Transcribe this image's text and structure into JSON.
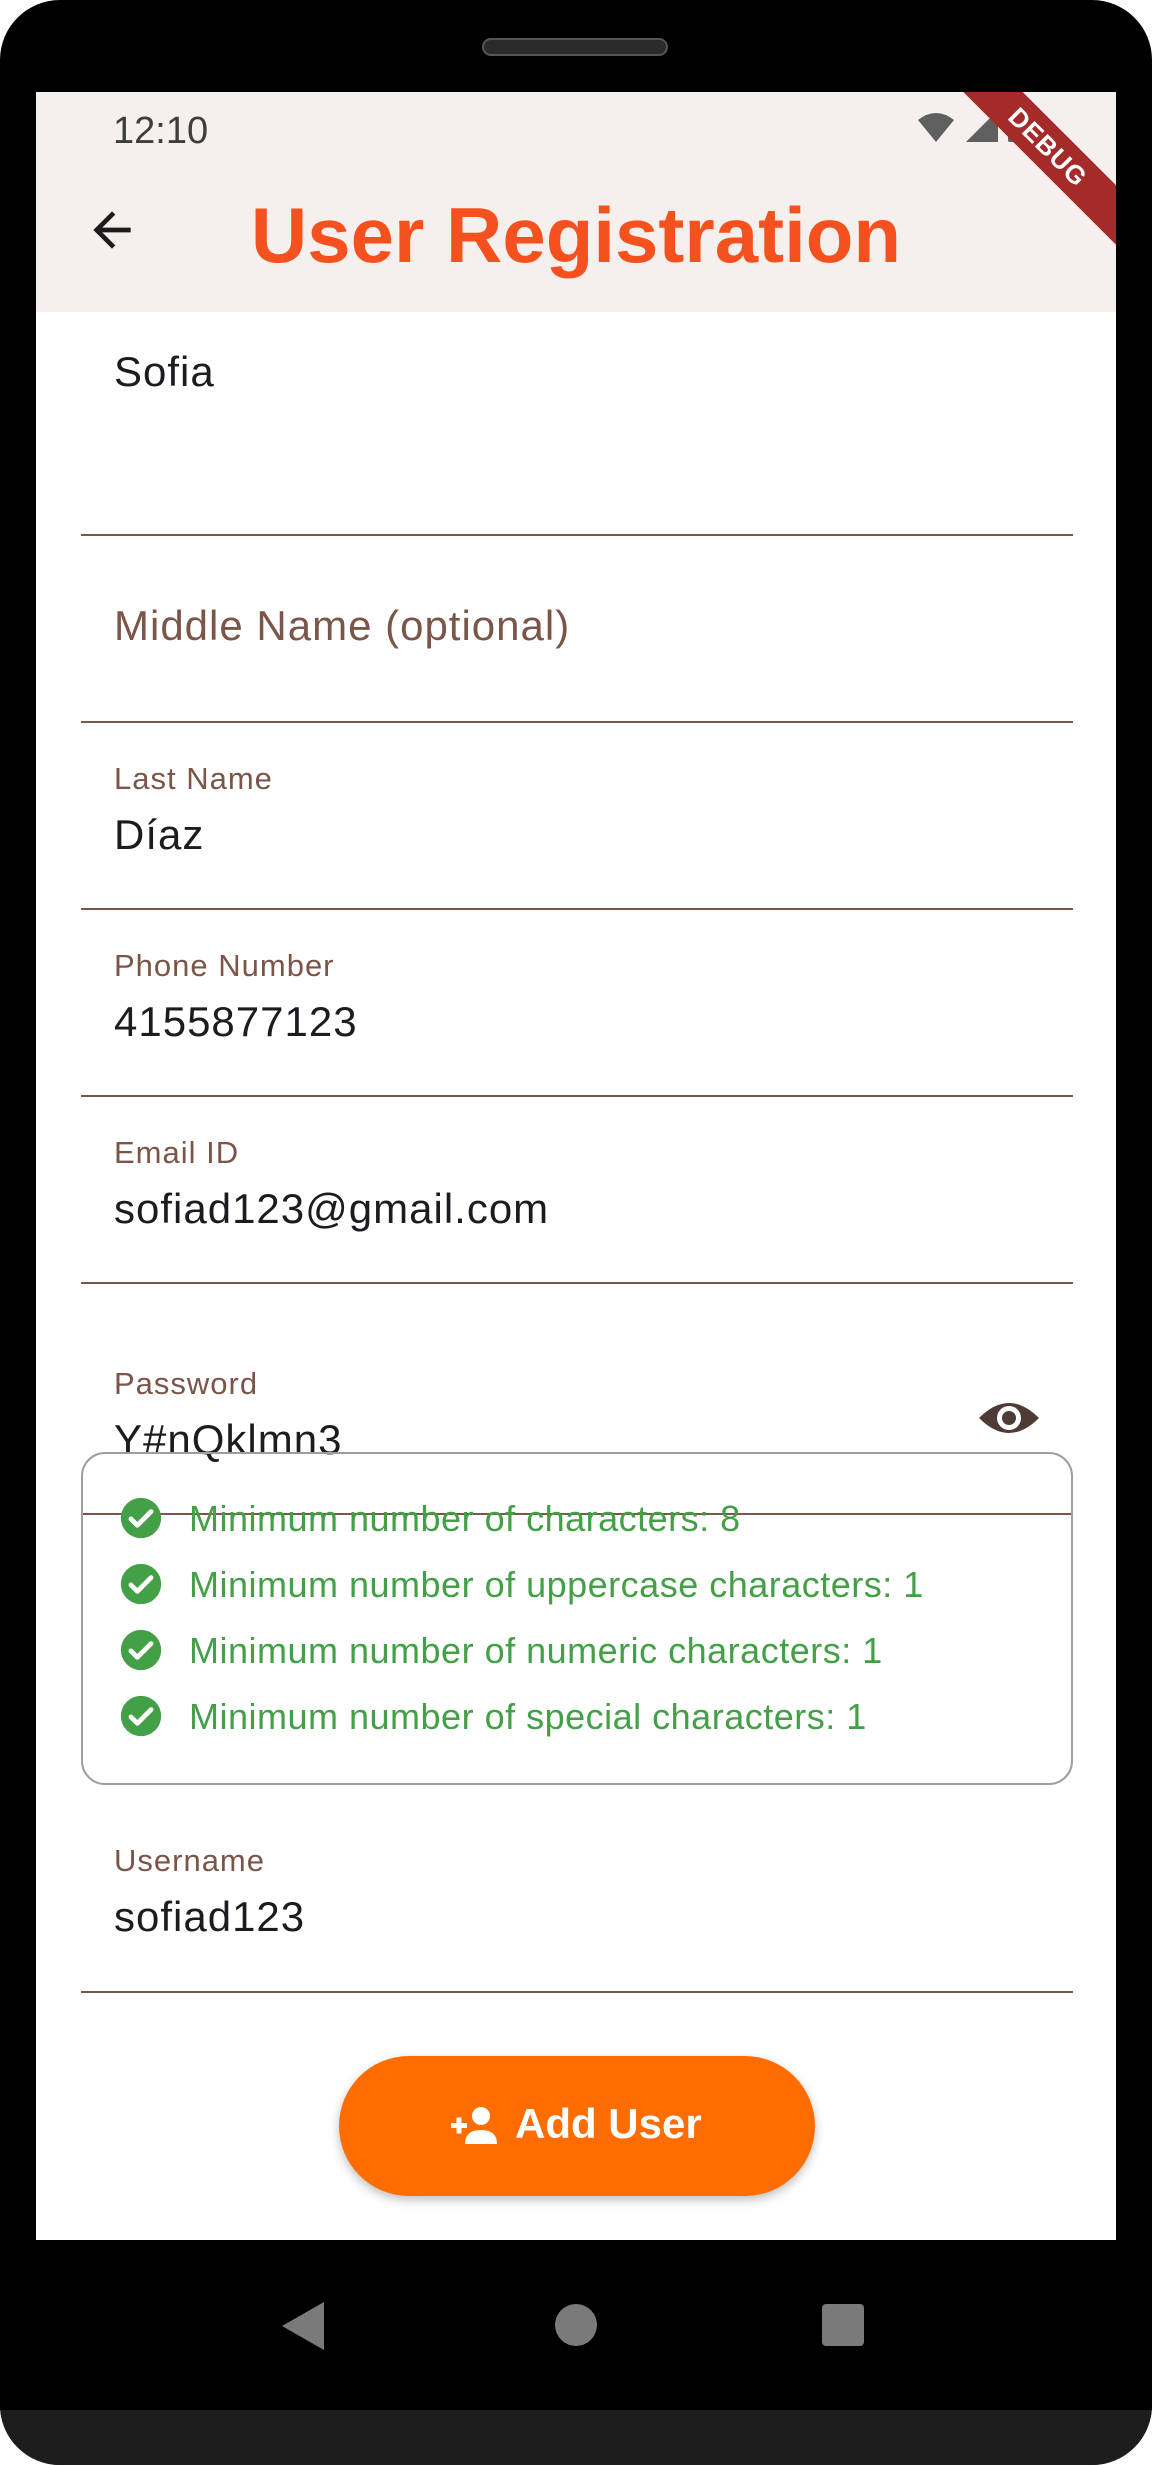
{
  "status_bar": {
    "time": "12:10"
  },
  "debug_banner": "DEBUG",
  "app_bar": {
    "title": "User Registration"
  },
  "form": {
    "first_name": {
      "value": "Sofia"
    },
    "middle_name": {
      "placeholder": "Middle Name (optional)"
    },
    "last_name": {
      "label": "Last Name",
      "value": "Díaz"
    },
    "phone": {
      "label": "Phone Number",
      "value": "4155877123"
    },
    "email": {
      "label": "Email ID",
      "value": "sofiad123@gmail.com"
    },
    "password": {
      "label": "Password",
      "value": "Y#nQklmn3"
    },
    "password_rules": [
      {
        "text": "Minimum number of characters: 8"
      },
      {
        "text": "Minimum number of uppercase characters: 1"
      },
      {
        "text": "Minimum number of numeric characters: 1"
      },
      {
        "text": "Minimum number of special characters: 1"
      }
    ],
    "username": {
      "label": "Username",
      "value": "sofiad123"
    }
  },
  "add_button": {
    "label": "Add User",
    "icon": "person-add-icon"
  },
  "colors": {
    "title": "#f4511e",
    "accent": "#ff6d00",
    "label": "#7a5548",
    "rule_ok": "#43a047",
    "appbar_bg": "#f5f0ed"
  }
}
